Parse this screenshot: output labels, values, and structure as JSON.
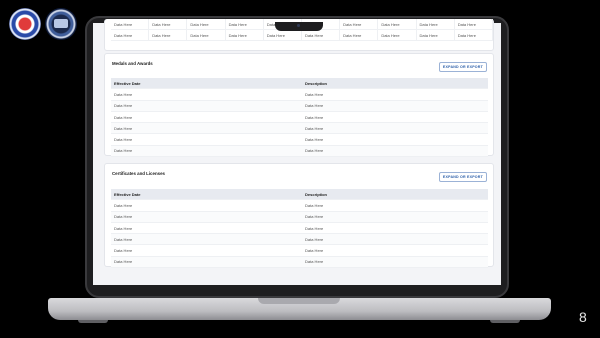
{
  "page_number": "8",
  "top_table": {
    "rows": [
      [
        "Data Here",
        "Data Here",
        "Data Here",
        "Data Here",
        "Data Here",
        "Data Here",
        "Data Here",
        "Data Here",
        "Data Here",
        "Data Here"
      ],
      [
        "Data Here",
        "Data Here",
        "Data Here",
        "Data Here",
        "Data Here",
        "Data Here",
        "Data Here",
        "Data Here",
        "Data Here",
        "Data Here"
      ]
    ]
  },
  "medals": {
    "title": "Medals and Awards",
    "export_label": "EXPAND OR EXPORT",
    "headers": [
      "Effective Date",
      "Description"
    ],
    "rows": [
      [
        "Data Here",
        "Data Here"
      ],
      [
        "Data Here",
        "Data Here"
      ],
      [
        "Data Here",
        "Data Here"
      ],
      [
        "Data Here",
        "Data Here"
      ],
      [
        "Data Here",
        "Data Here"
      ],
      [
        "Data Here",
        "Data Here"
      ]
    ]
  },
  "certs": {
    "title": "Certificates and Licenses",
    "export_label": "EXPAND OR EXPORT",
    "headers": [
      "Effective Date",
      "Description"
    ],
    "rows": [
      [
        "Data Here",
        "Data Here"
      ],
      [
        "Data Here",
        "Data Here"
      ],
      [
        "Data Here",
        "Data Here"
      ],
      [
        "Data Here",
        "Data Here"
      ],
      [
        "Data Here",
        "Data Here"
      ],
      [
        "Data Here",
        "Data Here"
      ]
    ]
  }
}
